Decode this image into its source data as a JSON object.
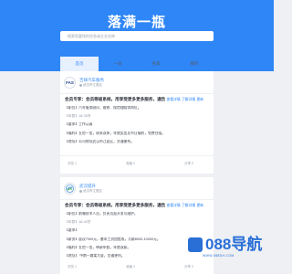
{
  "site": {
    "title": "落满一瓶"
  },
  "search": {
    "placeholder": "搜索您要找的信息或企业名称"
  },
  "tabs": [
    {
      "label": "首页",
      "active": true
    },
    {
      "label": "一览",
      "active": false
    },
    {
      "label": "名家",
      "active": false
    },
    {
      "label": "我的",
      "active": false
    }
  ],
  "cards": [
    {
      "company": "吉祥汽车服务",
      "logo_text": "FAS",
      "location": "武汉市江夏区",
      "headline": "会员专享：会员等级系统，用享受更多更多服务，通告",
      "headline_links": [
        "查看详情",
        "了解详情",
        "更新"
      ],
      "lines": [
        "【职位】汽车服务顾问、维修、保险理赔等岗位。",
        "【年龄】18-35岁",
        "【要求】工作认真",
        "【福利】五险一金，周末双休，年底奖金及节日福利，免费住宿。",
        "【地址】公司地址武汉市江夏区，交通便利。"
      ],
      "stats": [
        "浏览 1",
        "收藏 0",
        "分享 0"
      ]
    },
    {
      "company": "武汉提升",
      "location": "武汉市江夏区",
      "headline": "会员专享：会员等级系统，用享受更多更多服务，通告",
      "headline_links": [
        "查看详情",
        "了解详情",
        "更新"
      ],
      "lines": [
        "【职位】前端技术人员，负责页面开发与维护。",
        "【年龄】18-40岁",
        "【要求】",
        "【薪资】面议7000元，基本工资加提成，月薪8000-10000元。",
        "【福利】五险一金，带薪年假，年底双薪。",
        "【地址】 中南一路某大厦，交通便利。"
      ],
      "stats": [
        "浏览 1",
        "收藏 0",
        "分享 0"
      ]
    }
  ],
  "watermark": {
    "text": "088导航",
    "sub": "WWW.088DH.COM"
  },
  "colors": {
    "primary": "#2f86f6",
    "background": "#eef0f4"
  }
}
